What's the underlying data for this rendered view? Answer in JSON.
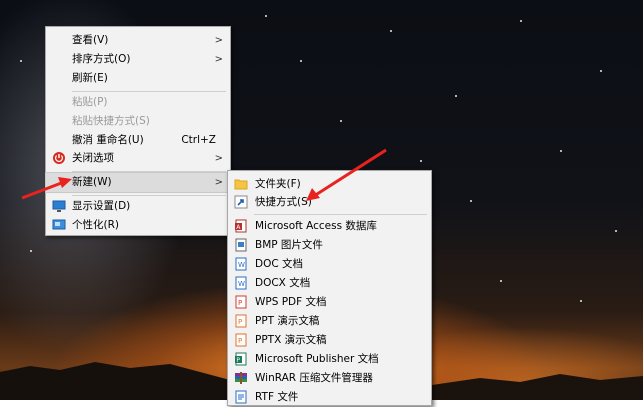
{
  "context_menu": {
    "items": [
      {
        "label": "查看(V)",
        "submenu": true
      },
      {
        "label": "排序方式(O)",
        "submenu": true
      },
      {
        "label": "刷新(E)"
      },
      {
        "label": "粘贴(P)",
        "disabled": true
      },
      {
        "label": "粘贴快捷方式(S)",
        "disabled": true
      },
      {
        "label": "撤消 重命名(U)",
        "shortcut": "Ctrl+Z"
      },
      {
        "label": "关闭选项",
        "submenu": true,
        "icon": "power-icon"
      },
      {
        "label": "新建(W)",
        "submenu": true,
        "highlighted": true
      },
      {
        "label": "显示设置(D)",
        "icon": "display-icon"
      },
      {
        "label": "个性化(R)",
        "icon": "personalize-icon"
      }
    ]
  },
  "new_submenu": {
    "items": [
      {
        "label": "文件夹(F)",
        "icon": "folder-icon"
      },
      {
        "label": "快捷方式(S)",
        "icon": "shortcut-icon"
      },
      {
        "label": "Microsoft Access 数据库",
        "icon": "access-icon"
      },
      {
        "label": "BMP 图片文件",
        "icon": "bmp-icon"
      },
      {
        "label": "DOC 文档",
        "icon": "doc-icon"
      },
      {
        "label": "DOCX 文档",
        "icon": "docx-icon"
      },
      {
        "label": "WPS PDF 文档",
        "icon": "pdf-icon"
      },
      {
        "label": "PPT 演示文稿",
        "icon": "ppt-icon"
      },
      {
        "label": "PPTX 演示文稿",
        "icon": "pptx-icon"
      },
      {
        "label": "Microsoft Publisher 文档",
        "icon": "publisher-icon"
      },
      {
        "label": "WinRAR 压缩文件管理器",
        "icon": "winrar-icon"
      },
      {
        "label": "RTF 文件",
        "icon": "rtf-icon"
      }
    ]
  },
  "colors": {
    "annotation_arrow": "#e8231f",
    "menu_background": "#f2f2f2",
    "highlight": "#dcdcdc"
  }
}
